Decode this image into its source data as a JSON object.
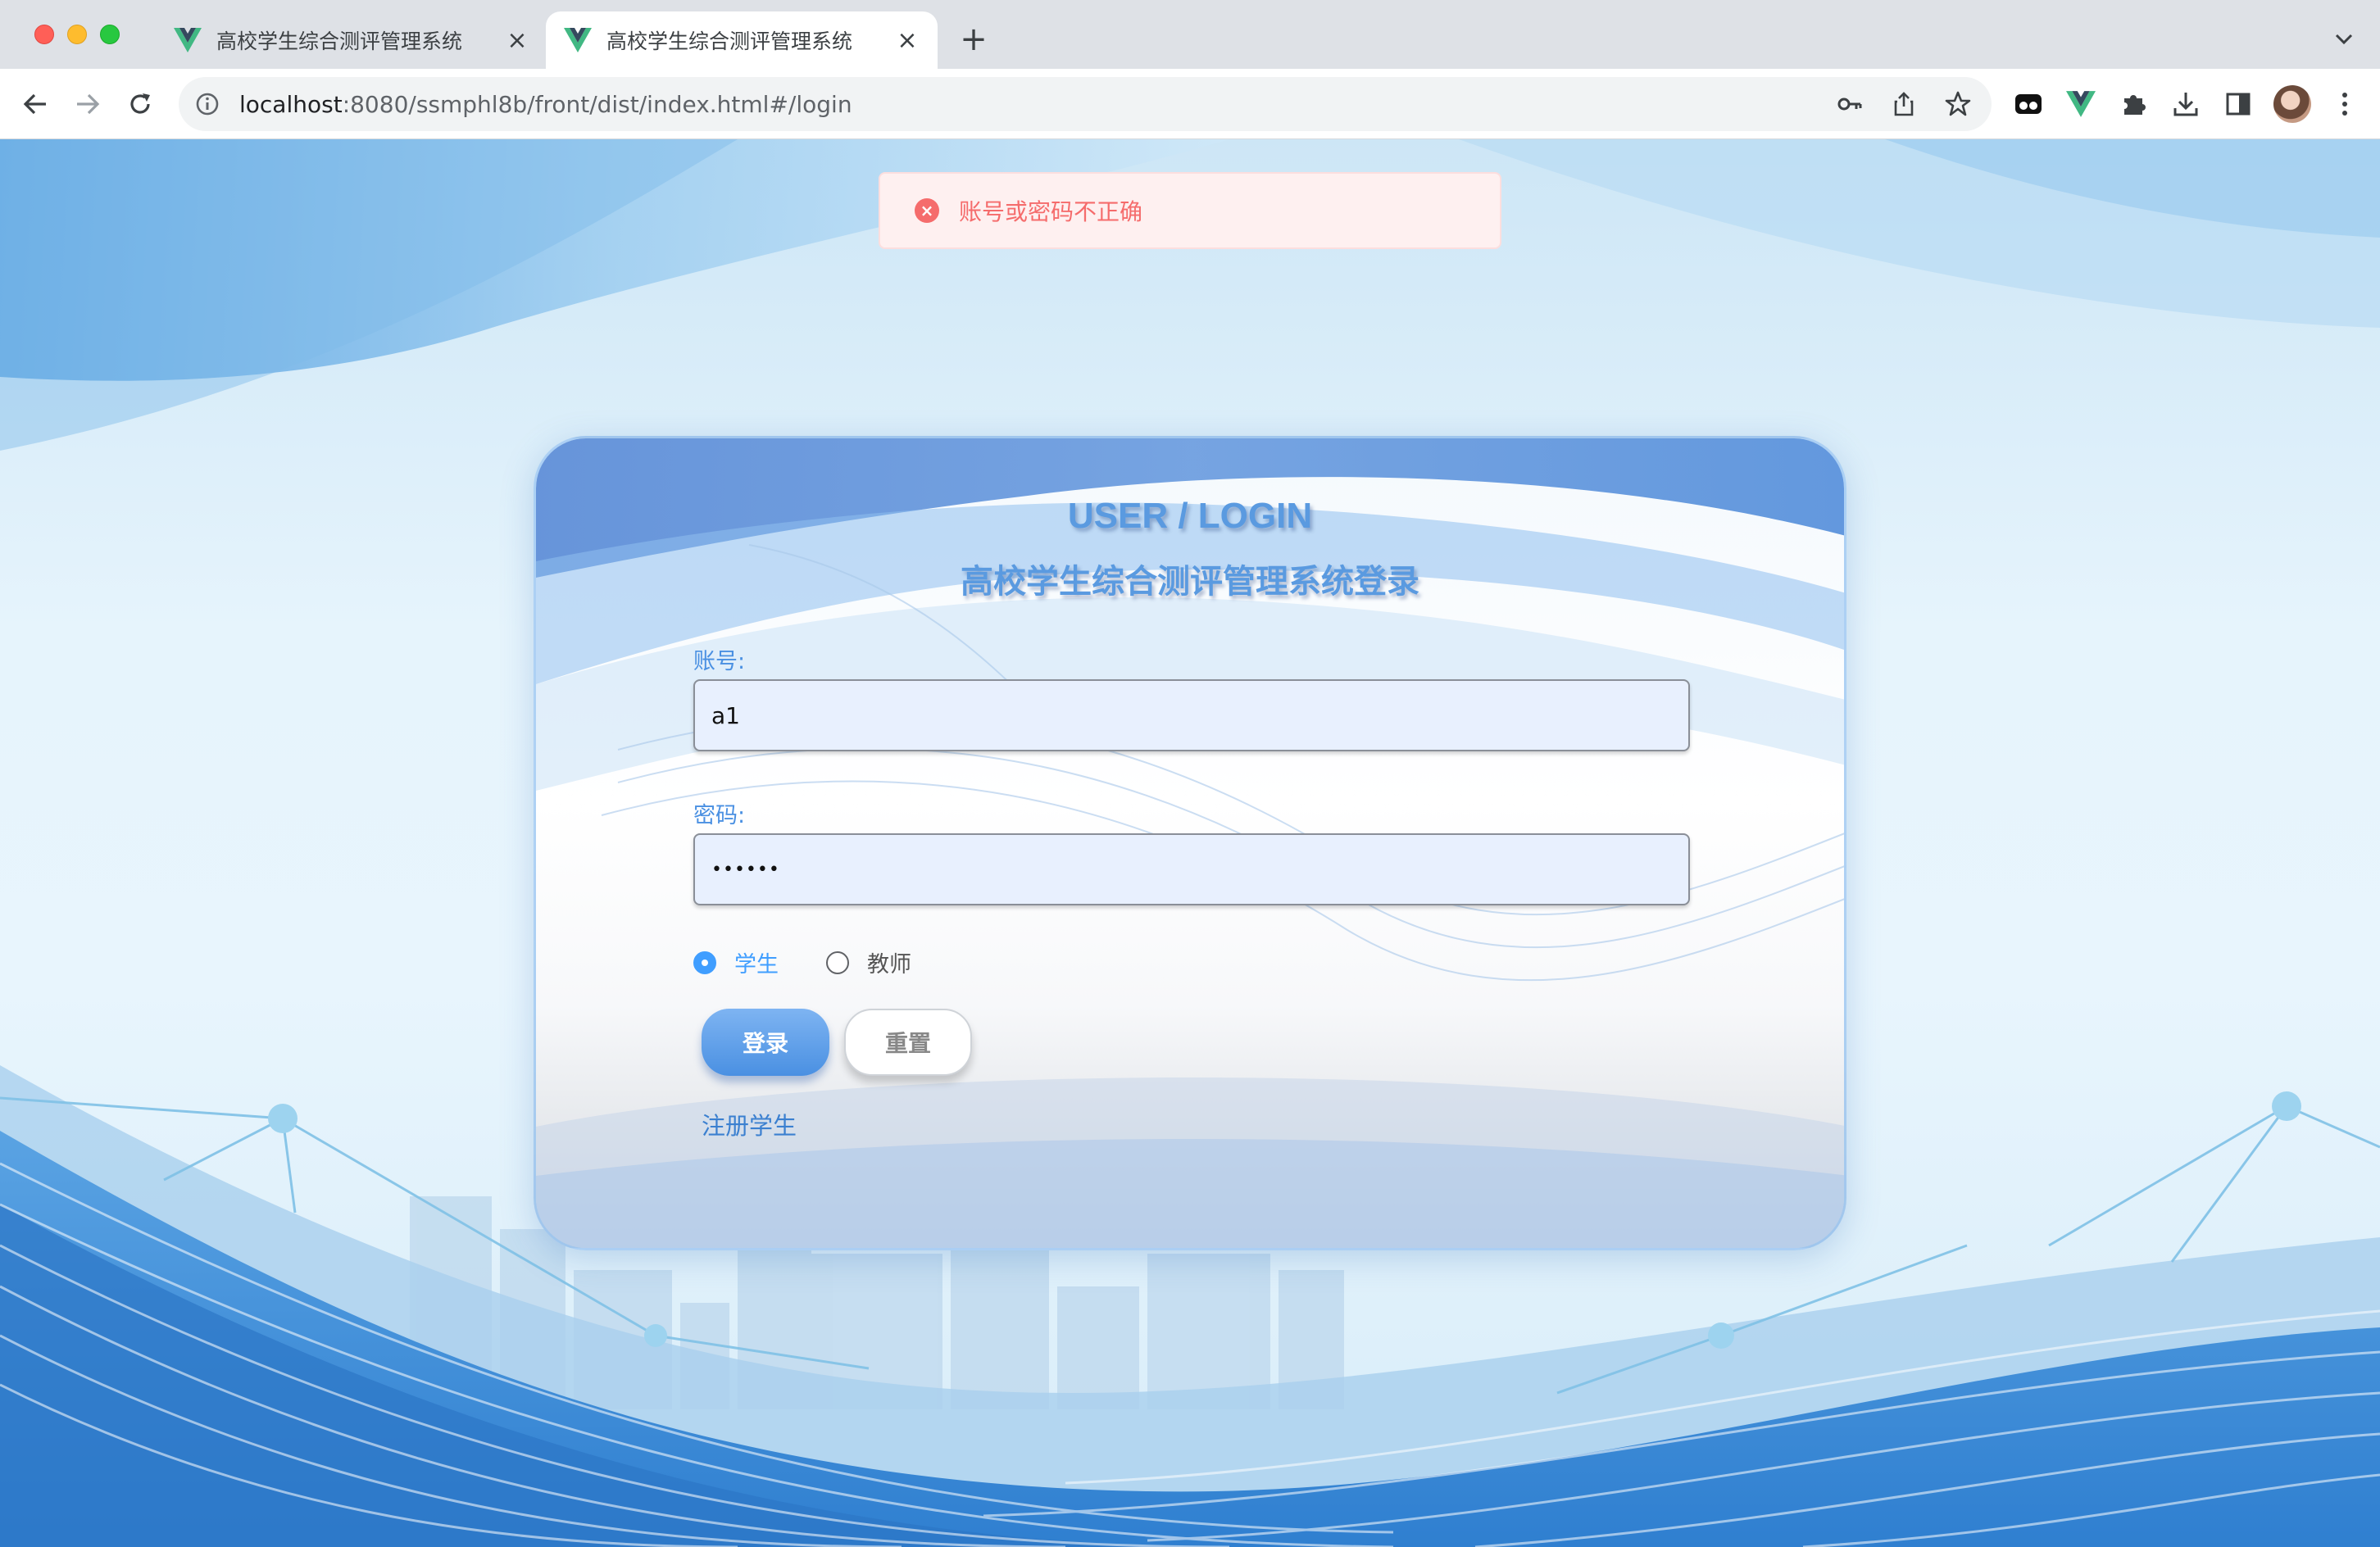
{
  "browser": {
    "tabs": [
      {
        "title": "高校学生综合测评管理系统",
        "active": false
      },
      {
        "title": "高校学生综合测评管理系统",
        "active": true
      }
    ],
    "url_host": "localhost",
    "url_rest": ":8080/ssmphl8b/front/dist/index.html#/login"
  },
  "toast": {
    "type": "error",
    "message": "账号或密码不正确"
  },
  "login": {
    "title_en": "USER / LOGIN",
    "title_cn": "高校学生综合测评管理系统登录",
    "account_label": "账号:",
    "account_value": "a1",
    "password_label": "密码:",
    "password_value": "••••••",
    "roles": [
      {
        "label": "学生",
        "checked": true
      },
      {
        "label": "教师",
        "checked": false
      }
    ],
    "login_button": "登录",
    "reset_button": "重置",
    "register_link": "注册学生"
  },
  "colors": {
    "accent": "#4a90e2",
    "error": "#f56c6c",
    "error_bg": "#fef0f0"
  }
}
